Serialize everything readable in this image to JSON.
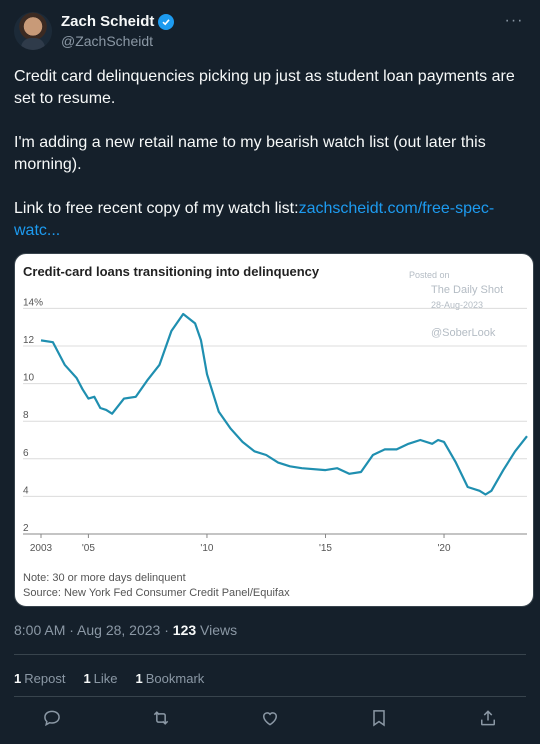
{
  "author": {
    "display_name": "Zach Scheidt",
    "handle": "@ZachScheidt",
    "verified": true
  },
  "tweet": {
    "para1": "Credit card delinquencies picking up just as student loan payments are set to resume.",
    "para2": "I'm adding a new retail name to my bearish watch list (out later this morning).",
    "link_prefix": "Link to free recent copy of my watch list:",
    "link_text": "zachscheidt.com/free-spec-watc..."
  },
  "card": {
    "watermark": {
      "posted_on": "Posted on",
      "source": "The Daily Shot",
      "date": "28-Aug-2023",
      "handle": "@SoberLook"
    },
    "note": "Note: 30 or more days delinquent",
    "source": "Source: New York Fed Consumer Credit Panel/Equifax"
  },
  "chart_data": {
    "type": "line",
    "title": "Credit-card loans transitioning into delinquency",
    "y_tick_labels": [
      "14%",
      "12",
      "10",
      "8",
      "6",
      "4",
      "2"
    ],
    "y_ticks": [
      14,
      12,
      10,
      8,
      6,
      4,
      2
    ],
    "x_tick_labels": [
      "2003",
      "'05",
      "'10",
      "'15",
      "'20"
    ],
    "x_ticks": [
      2003,
      2005,
      2010,
      2015,
      2020
    ],
    "xlim": [
      2003,
      2023.5
    ],
    "ylim": [
      2,
      14.5
    ],
    "grid": "horizontal",
    "color": "#1f8fb0",
    "series": [
      {
        "x": [
          2003.0,
          2003.5,
          2003.75,
          2004.0,
          2004.5,
          2004.75,
          2005.0,
          2005.25,
          2005.5,
          2005.75,
          2006.0,
          2006.5,
          2007.0,
          2007.5,
          2008.0,
          2008.5,
          2009.0,
          2009.5,
          2009.75,
          2010.0,
          2010.5,
          2011.0,
          2011.5,
          2012.0,
          2012.5,
          2013.0,
          2013.5,
          2014.0,
          2015.0,
          2015.5,
          2016.0,
          2016.5,
          2017.0,
          2017.5,
          2018.0,
          2018.5,
          2019.0,
          2019.5,
          2019.75,
          2020.0,
          2020.5,
          2021.0,
          2021.5,
          2021.75,
          2022.0,
          2022.5,
          2023.0,
          2023.5
        ],
        "y": [
          12.3,
          12.2,
          11.6,
          11.0,
          10.3,
          9.7,
          9.2,
          9.3,
          8.7,
          8.6,
          8.4,
          9.2,
          9.3,
          10.2,
          11.0,
          12.8,
          13.7,
          13.2,
          12.3,
          10.5,
          8.5,
          7.6,
          6.9,
          6.4,
          6.2,
          5.8,
          5.6,
          5.5,
          5.4,
          5.5,
          5.2,
          5.3,
          6.2,
          6.5,
          6.5,
          6.8,
          7.0,
          6.8,
          7.0,
          6.9,
          5.8,
          4.5,
          4.3,
          4.1,
          4.3,
          5.4,
          6.4,
          7.2
        ]
      }
    ]
  },
  "timestamp": "8:00 AM · Aug 28, 2023 · ",
  "views_count": "123",
  "views_label": " Views",
  "stats": {
    "repost_count": "1",
    "repost_label": "Repost",
    "like_count": "1",
    "like_label": "Like",
    "bookmark_count": "1",
    "bookmark_label": "Bookmark"
  },
  "icons": [
    "reply-icon",
    "retweet-icon",
    "like-icon",
    "bookmark-icon",
    "share-icon",
    "more-icon",
    "verified-icon"
  ]
}
